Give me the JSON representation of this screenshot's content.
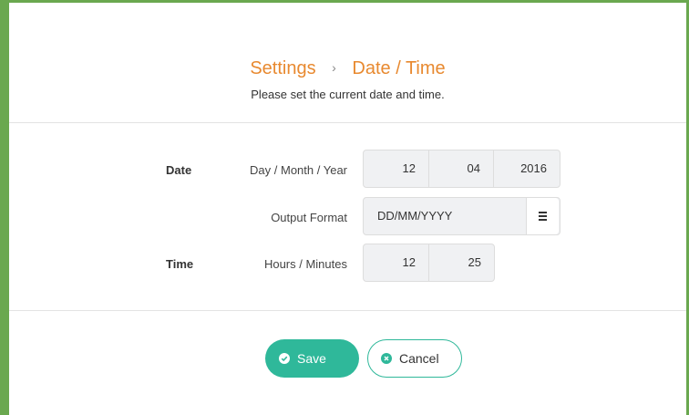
{
  "header": {
    "breadcrumb_parent": "Settings",
    "breadcrumb_separator": "›",
    "breadcrumb_current": "Date / Time",
    "subtitle": "Please set the current date and time."
  },
  "form": {
    "date_section": "Date",
    "date_field_label": "Day / Month / Year",
    "day": "12",
    "month": "04",
    "year": "2016",
    "format_label": "Output Format",
    "format_value": "DD/MM/YYYY",
    "format_icon": "menu-icon",
    "time_section": "Time",
    "time_field_label": "Hours / Minutes",
    "hours": "12",
    "minutes": "25"
  },
  "actions": {
    "save_label": "Save",
    "save_icon": "check-circle-icon",
    "cancel_label": "Cancel",
    "cancel_icon": "x-circle-icon"
  },
  "colors": {
    "accent": "#2fb89a",
    "title": "#e8892f",
    "frame": "#6aa84f"
  }
}
